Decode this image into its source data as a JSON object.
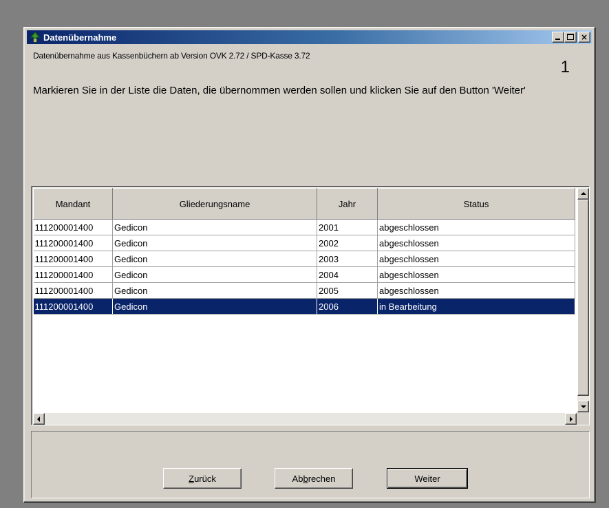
{
  "window": {
    "title": "Datenübernahme"
  },
  "header": {
    "subtitle": "Datenübernahme aus Kassenbüchern ab Version OVK 2.72 / SPD-Kasse 3.72",
    "step_number": "1",
    "instruction": "Markieren Sie in der Liste die Daten, die übernommen werden sollen und klicken Sie auf den Button 'Weiter'"
  },
  "grid": {
    "columns": [
      "Mandant",
      "Gliederungsname",
      "Jahr",
      "Status"
    ],
    "rows": [
      [
        "111200001400",
        "Gedicon",
        "2001",
        "abgeschlossen"
      ],
      [
        "111200001400",
        "Gedicon",
        "2002",
        "abgeschlossen"
      ],
      [
        "111200001400",
        "Gedicon",
        "2003",
        "abgeschlossen"
      ],
      [
        "111200001400",
        "Gedicon",
        "2004",
        "abgeschlossen"
      ],
      [
        "111200001400",
        "Gedicon",
        "2005",
        "abgeschlossen"
      ],
      [
        "111200001400",
        "Gedicon",
        "2006",
        "in Bearbeitung"
      ]
    ],
    "selected_row": 5
  },
  "buttons": {
    "back_label": "Zurück",
    "back_mnemonic": "Z",
    "back_rest": "urück",
    "cancel_label": "Abbrechen",
    "cancel_pre": "Ab",
    "cancel_mnemonic": "b",
    "cancel_post": "rechen",
    "next_label": "Weiter"
  },
  "colors": {
    "title_active": "#0a246a",
    "selection": "#0a246a",
    "face": "#d4d0c8",
    "desktop": "#808080"
  },
  "icons": {
    "title": "tree-download-icon"
  }
}
